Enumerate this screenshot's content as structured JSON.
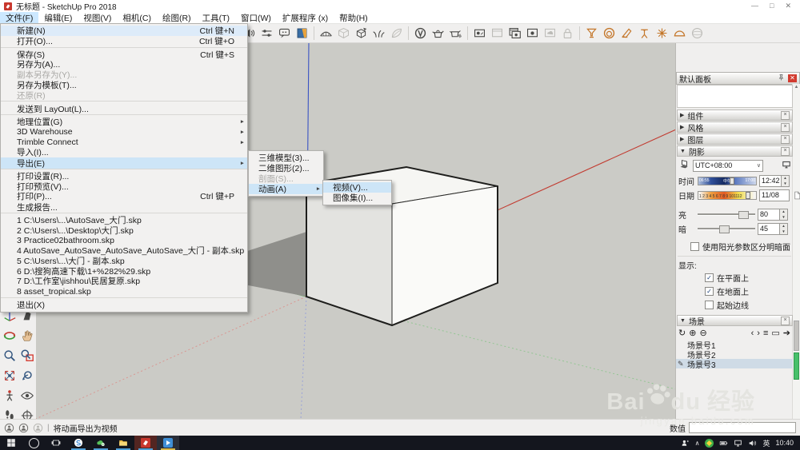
{
  "window": {
    "title": "无标题 - SketchUp Pro 2018",
    "minimize": "—",
    "maximize": "□",
    "close": "✕"
  },
  "menubar": {
    "items": [
      {
        "label": "文件(F)",
        "active": true
      },
      {
        "label": "编辑(E)"
      },
      {
        "label": "视图(V)"
      },
      {
        "label": "相机(C)"
      },
      {
        "label": "绘图(R)"
      },
      {
        "label": "工具(T)"
      },
      {
        "label": "窗口(W)"
      },
      {
        "label": "扩展程序 (x)"
      },
      {
        "label": "帮助(H)"
      }
    ]
  },
  "toolbar": {
    "icons": [
      {
        "name": "sound-toggle-icon",
        "sym": "speaker",
        "tone": "dark"
      },
      {
        "name": "mixer-icon",
        "sym": "mixer",
        "tone": "dark"
      },
      {
        "name": "chat-bubble-icon",
        "sym": "bubble",
        "tone": "dark"
      },
      {
        "name": "instructor-panel-icon",
        "sym": "infopanel",
        "tone": "multi"
      },
      {
        "sep": true
      },
      {
        "name": "sandbox-terrain-icon",
        "sym": "terrain",
        "tone": "dark"
      },
      {
        "name": "soften-edges-icon",
        "sym": "cube",
        "tone": "gray"
      },
      {
        "name": "explode-box-icon",
        "sym": "cubea",
        "tone": "dark"
      },
      {
        "name": "vegetation-icon",
        "sym": "grass",
        "tone": "dark"
      },
      {
        "name": "leaf-icon",
        "sym": "leaf",
        "tone": "gray"
      },
      {
        "sep": true
      },
      {
        "name": "vray-logo-icon",
        "sym": "vray",
        "tone": "dark"
      },
      {
        "name": "vray-asset-editor-icon",
        "sym": "teapot",
        "tone": "dark"
      },
      {
        "name": "vray-interactive-render-icon",
        "sym": "teapoth",
        "tone": "dark"
      },
      {
        "sep": true
      },
      {
        "name": "render-scene-icon",
        "sym": "rtable",
        "tone": "dark"
      },
      {
        "name": "render-last-icon",
        "sym": "frame",
        "tone": "gray"
      },
      {
        "name": "frame-buffer-icon",
        "sym": "frames",
        "tone": "dark"
      },
      {
        "name": "batch-render-icon",
        "sym": "fobj",
        "tone": "dark"
      },
      {
        "name": "cloud-render-icon",
        "sym": "fcloud",
        "tone": "gray"
      },
      {
        "name": "lock-icon",
        "sym": "lock",
        "tone": "gray"
      },
      {
        "sep": true
      },
      {
        "name": "vray-plane-light-icon",
        "sym": "funnel",
        "tone": "orange"
      },
      {
        "name": "vray-dome-light-icon",
        "sym": "ring",
        "tone": "orange"
      },
      {
        "name": "vray-cone-light-icon",
        "sym": "cone",
        "tone": "orange"
      },
      {
        "name": "vray-spot-light-icon",
        "sym": "stand",
        "tone": "orange"
      },
      {
        "name": "vray-omni-light-icon",
        "sym": "star",
        "tone": "orange"
      },
      {
        "name": "vray-ies-light-icon",
        "sym": "dome",
        "tone": "orange"
      },
      {
        "name": "vray-sphere-light-icon",
        "sym": "sphere",
        "tone": "gray"
      }
    ]
  },
  "left_toolbar": {
    "icons": [
      {
        "name": "axes-tool-icon",
        "sym": "axes"
      },
      {
        "name": "solid-tool-icon",
        "sym": "wedge"
      },
      {
        "name": "orbit-tool-icon",
        "sym": "orbit"
      },
      {
        "name": "pan-tool-icon",
        "sym": "hand"
      },
      {
        "name": "zoom-tool-icon",
        "sym": "zoom"
      },
      {
        "name": "zoom-window-tool-icon",
        "sym": "zoomwin"
      },
      {
        "name": "zoom-extents-tool-icon",
        "sym": "zoomext"
      },
      {
        "name": "previous-view-tool-icon",
        "sym": "prev"
      },
      {
        "name": "position-camera-tool-icon",
        "sym": "camfig"
      },
      {
        "name": "look-around-tool-icon",
        "sym": "eye"
      },
      {
        "name": "walk-tool-icon",
        "sym": "walk"
      },
      {
        "name": "camera-target-tool-icon",
        "sym": "target"
      }
    ]
  },
  "file_menu": {
    "items": [
      {
        "label": "新建(N)",
        "shortcut": "Ctrl 键+N",
        "focus": true
      },
      {
        "label": "打开(O)...",
        "shortcut": "Ctrl 键+O",
        "sep_after": true
      },
      {
        "label": "保存(S)",
        "shortcut": "Ctrl 键+S"
      },
      {
        "label": "另存为(A)..."
      },
      {
        "label": "副本另存为(Y)...",
        "disabled": true
      },
      {
        "label": "另存为模板(T)..."
      },
      {
        "label": "还原(R)",
        "disabled": true,
        "sep_after": true
      },
      {
        "label": "发送到 LayOut(L)...",
        "sep_after": true
      },
      {
        "label": "地理位置(G)",
        "submenu": true
      },
      {
        "label": "3D Warehouse",
        "submenu": true
      },
      {
        "label": "Trimble Connect",
        "submenu": true
      },
      {
        "label": "导入(I)..."
      },
      {
        "label": "导出(E)",
        "submenu": true,
        "highlighted": true,
        "sep_after": true
      },
      {
        "label": "打印设置(R)..."
      },
      {
        "label": "打印预览(V)..."
      },
      {
        "label": "打印(P)...",
        "shortcut": "Ctrl 键+P"
      },
      {
        "label": "生成报告...",
        "sep_after": true
      },
      {
        "label": "1 C:\\Users\\...\\AutoSave_大门.skp"
      },
      {
        "label": "2 C:\\Users\\...\\Desktop\\大门.skp"
      },
      {
        "label": "3 Practice02bathroom.skp"
      },
      {
        "label": "4 AutoSave_AutoSave_AutoSave_AutoSave_大门 - 副本.skp"
      },
      {
        "label": "5 C:\\Users\\...\\大门 - 副本.skp"
      },
      {
        "label": "6 D:\\搜狗高速下载\\1+%282%29.skp"
      },
      {
        "label": "7 D:\\工作室\\jishhou\\民居复原.skp"
      },
      {
        "label": "8 asset_tropical.skp",
        "sep_after": true
      },
      {
        "label": "退出(X)"
      }
    ]
  },
  "export_submenu": {
    "items": [
      {
        "label": "三维模型(3)..."
      },
      {
        "label": "二维图形(2)..."
      },
      {
        "label": "剖面(S)...",
        "disabled": true
      },
      {
        "label": "动画(A)",
        "submenu": true,
        "highlighted": true
      }
    ]
  },
  "animation_submenu": {
    "items": [
      {
        "label": "视频(V)...",
        "highlighted": true
      },
      {
        "label": "图像集(I)..."
      }
    ]
  },
  "panel": {
    "title": "默认面板",
    "sections": {
      "components": "组件",
      "styles": "风格",
      "layers": "图层",
      "shadows": "阴影",
      "scenes": "场景"
    },
    "shadow": {
      "timezone": "UTC+08:00",
      "time_label": "时间",
      "time_value": "12:42",
      "time_pct": 57,
      "time_marks": [
        "06:55",
        "中午",
        "17:00"
      ],
      "date_label": "日期",
      "date_value": "11/08",
      "date_pct": 85,
      "date_marks": "1 2 3 4 5 6 7 8 9 101112",
      "light_label": "亮",
      "light_value": "80",
      "light_pct": 78,
      "dark_label": "暗",
      "dark_value": "45",
      "dark_pct": 45,
      "use_sun_label": "使用阳光参数区分明暗面",
      "display_label": "显示:",
      "checks": [
        {
          "label": "在平面上",
          "checked": true
        },
        {
          "label": "在地面上",
          "checked": true
        },
        {
          "label": "起始边线",
          "checked": false
        }
      ]
    },
    "scenes": {
      "tools": [
        {
          "name": "update-scene-icon",
          "glyph": "↻"
        },
        {
          "name": "add-scene-icon",
          "glyph": "⊕"
        },
        {
          "name": "remove-scene-icon",
          "glyph": "⊖"
        },
        {
          "name": "move-scene-left-icon",
          "glyph": "‹"
        },
        {
          "name": "move-scene-right-icon",
          "glyph": "›"
        },
        {
          "name": "view-list-icon",
          "glyph": "≡"
        },
        {
          "name": "show-details-icon",
          "glyph": "▭"
        },
        {
          "name": "scene-options-icon",
          "glyph": "➔"
        }
      ],
      "items": [
        {
          "label": "场景号1"
        },
        {
          "label": "场景号2"
        },
        {
          "label": "场景号3",
          "selected": true
        }
      ]
    }
  },
  "statusbar": {
    "hint": "将动画导出为视频",
    "divider": "|",
    "measure_label": "数值",
    "measure_value": ""
  },
  "taskbar": {
    "lang": "英",
    "time": "10:40"
  },
  "watermark": {
    "brand_a": "Bai",
    "brand_b": "du",
    "suffix": "经验",
    "url": "jingyan.baidu.com"
  },
  "colors": {
    "accent_blue": "#cde5f7",
    "panel_close_red": "#d23b2f",
    "axis_red": "#c23b30",
    "axis_green": "#4f9e4f",
    "axis_blue": "#3a53c4",
    "vray_orange": "#c4772b"
  }
}
